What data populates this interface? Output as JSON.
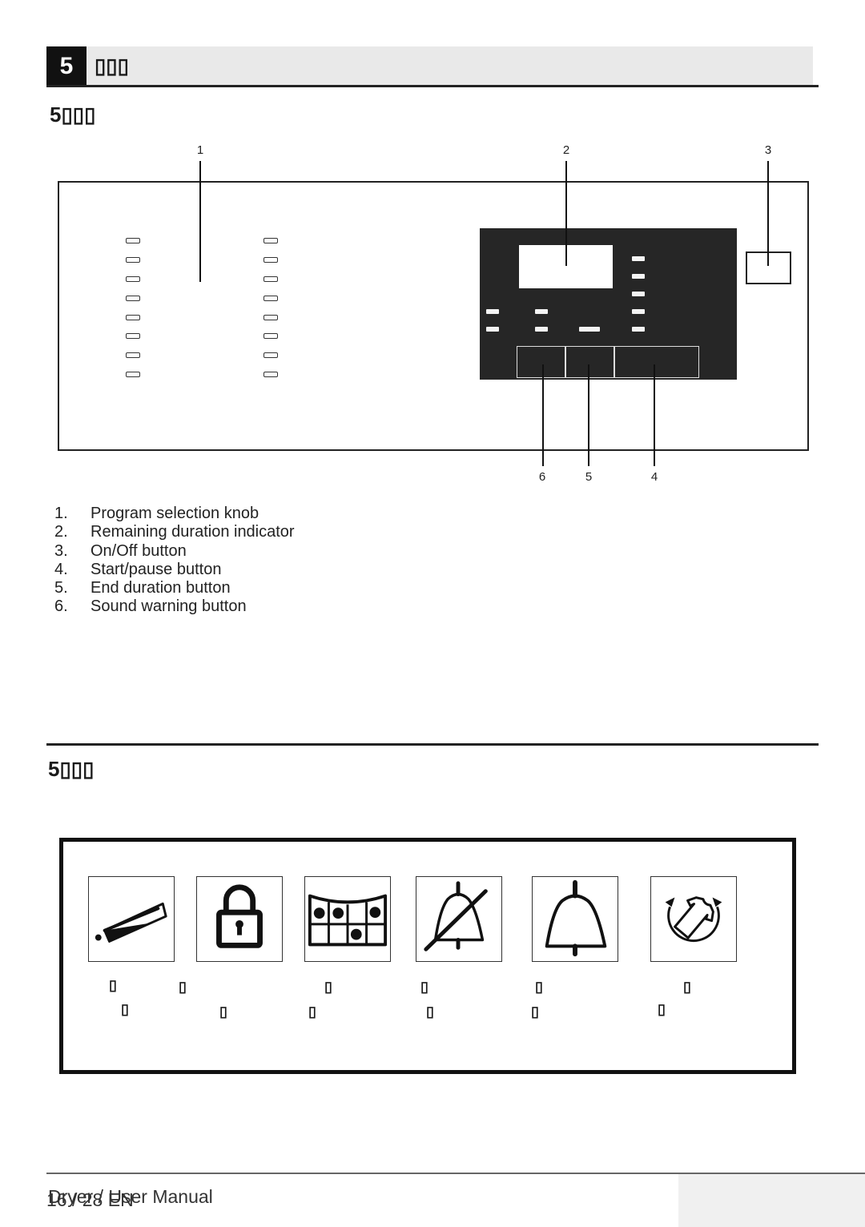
{
  "section": {
    "number": "5",
    "title": "▯▯▯"
  },
  "subsection_1": {
    "title": "5▯▯▯",
    "callouts": [
      "1",
      "2",
      "3",
      "4",
      "5",
      "6"
    ],
    "legend": [
      {
        "num": "1.",
        "label": "Program selection knob"
      },
      {
        "num": "2.",
        "label": "Remaining duration indicator"
      },
      {
        "num": "3.",
        "label": "On/Off button"
      },
      {
        "num": "4.",
        "label": "Start/pause button"
      },
      {
        "num": "5.",
        "label": "End duration button"
      },
      {
        "num": "6.",
        "label": "Sound warning button"
      }
    ]
  },
  "subsection_2": {
    "title": "5▯▯▯",
    "symbols": [
      {
        "icon": "detergent-tube-icon",
        "glyphs": [
          "▯",
          "▯"
        ]
      },
      {
        "icon": "child-lock-icon",
        "glyphs": [
          "▯",
          "▯"
        ]
      },
      {
        "icon": "filter-grid-icon",
        "glyphs": [
          "▯",
          "▯"
        ]
      },
      {
        "icon": "sound-off-bell-icon",
        "glyphs": [
          "▯",
          "▯"
        ]
      },
      {
        "icon": "sound-on-bell-icon",
        "glyphs": [
          "▯",
          "▯"
        ]
      },
      {
        "icon": "anti-crease-icon",
        "glyphs": [
          "▯",
          "▯"
        ]
      }
    ]
  },
  "footer": {
    "manual_title": "Dryer / User Manual",
    "page": "16 / 28 EN"
  }
}
